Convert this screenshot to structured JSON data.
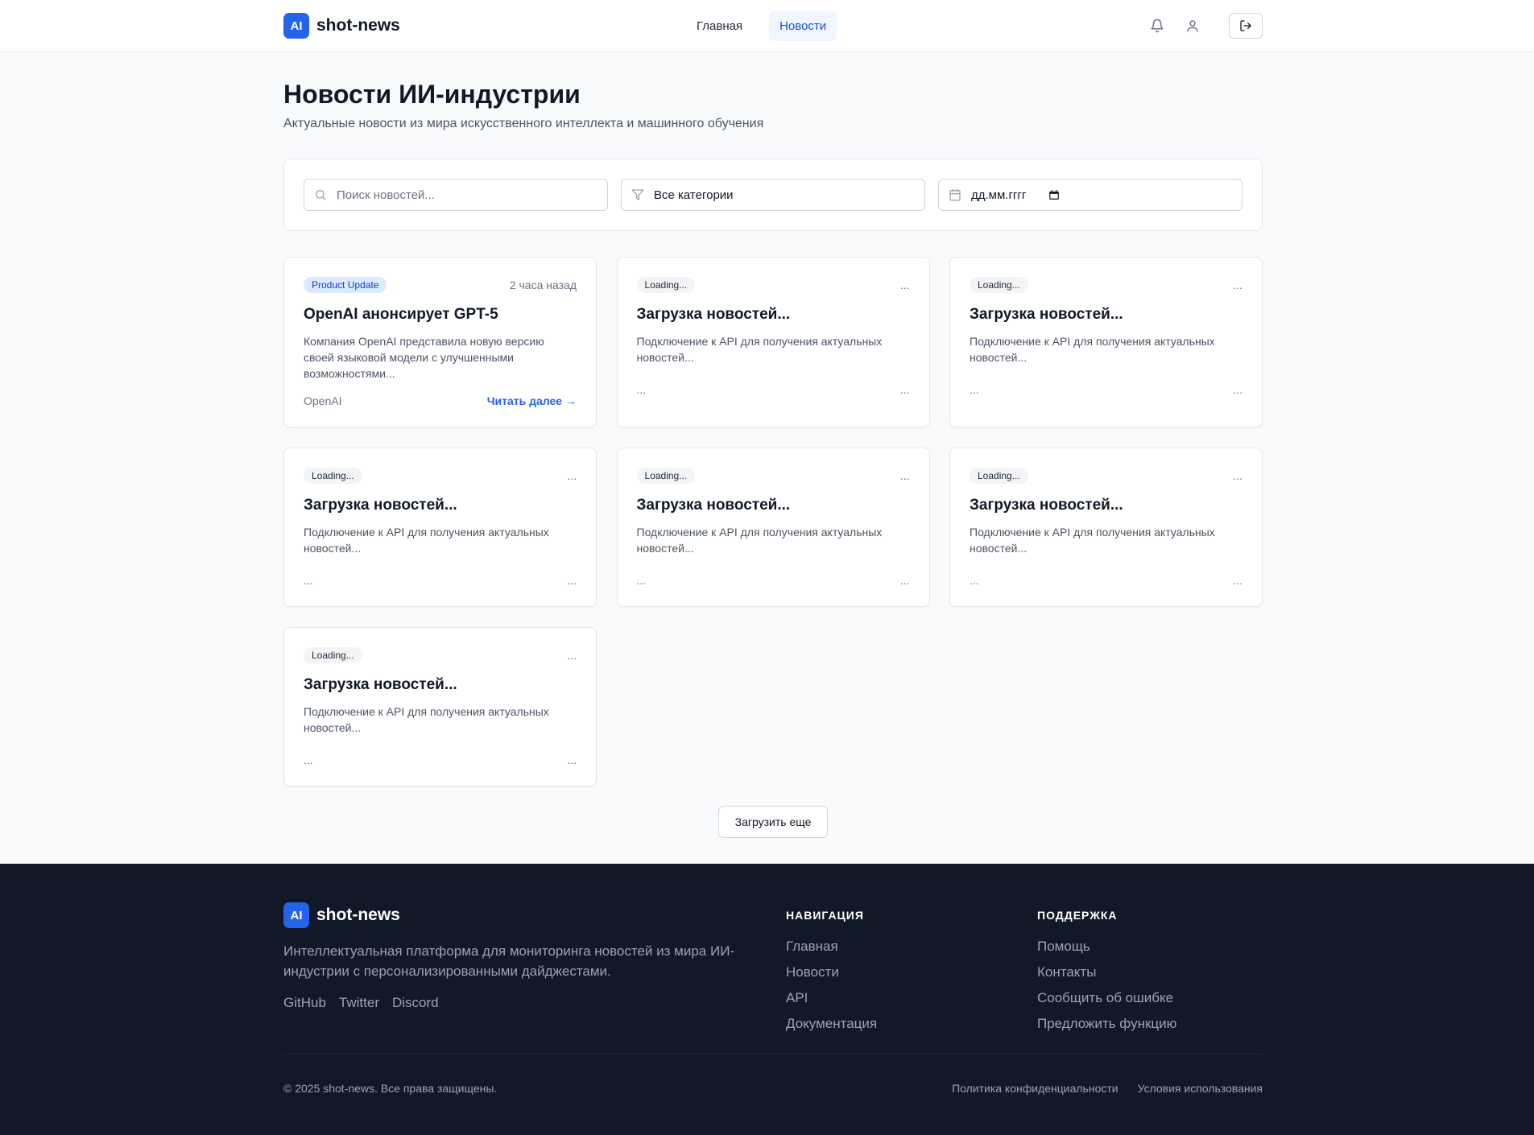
{
  "brand": {
    "logo_text": "AI",
    "name": "shot-news"
  },
  "header": {
    "nav": [
      {
        "label": "Главная",
        "active": false
      },
      {
        "label": "Новости",
        "active": true
      }
    ],
    "icons": [
      "bell-icon",
      "user-icon",
      "logout-icon"
    ]
  },
  "page": {
    "title": "Новости ИИ-индустрии",
    "subtitle": "Актуальные новости из мира искусственного интеллекта и машинного обучения"
  },
  "filters": {
    "search_placeholder": "Поиск новостей...",
    "category_value": "Все категории",
    "date_value": "дд.мм.гггг"
  },
  "news": {
    "featured": {
      "badge": "Product Update",
      "time": "2 часа назад",
      "title": "OpenAI анонсирует GPT-5",
      "description": "Компания OpenAI представила новую версию своей языковой модели с улучшенными возможностями...",
      "source": "OpenAI",
      "read_more": "Читать далее →"
    },
    "loading": [
      {
        "badge": "Loading...",
        "time": "...",
        "title": "Загрузка новостей...",
        "description": "Подключение к API для получения актуальных новостей...",
        "source": "...",
        "meta": "..."
      },
      {
        "badge": "Loading...",
        "time": "...",
        "title": "Загрузка новостей...",
        "description": "Подключение к API для получения актуальных новостей...",
        "source": "...",
        "meta": "..."
      },
      {
        "badge": "Loading...",
        "time": "...",
        "title": "Загрузка новостей...",
        "description": "Подключение к API для получения актуальных новостей...",
        "source": "...",
        "meta": "..."
      },
      {
        "badge": "Loading...",
        "time": "...",
        "title": "Загрузка новостей...",
        "description": "Подключение к API для получения актуальных новостей...",
        "source": "...",
        "meta": "..."
      },
      {
        "badge": "Loading...",
        "time": "...",
        "title": "Загрузка новостей...",
        "description": "Подключение к API для получения актуальных новостей...",
        "source": "...",
        "meta": "..."
      },
      {
        "badge": "Loading...",
        "time": "...",
        "title": "Загрузка новостей...",
        "description": "Подключение к API для получения актуальных новостей...",
        "source": "...",
        "meta": "..."
      }
    ],
    "load_more": "Загрузить еще"
  },
  "footer": {
    "description": "Интеллектуальная платформа для мониторинга новостей из мира ИИ-индустрии с персонализированными дайджестами.",
    "social": [
      "GitHub",
      "Twitter",
      "Discord"
    ],
    "nav_title": "НАВИГАЦИЯ",
    "nav_links": [
      "Главная",
      "Новости",
      "API",
      "Документация"
    ],
    "support_title": "ПОДДЕРЖКА",
    "support_links": [
      "Помощь",
      "Контакты",
      "Сообщить об ошибке",
      "Предложить функцию"
    ],
    "copyright": "© 2025 shot-news. Все права защищены.",
    "legal": [
      "Политика конфиденциальности",
      "Условия использования"
    ]
  },
  "colors": {
    "accent": "#2563eb",
    "footer_bg": "#111827",
    "page_bg": "#f9fafb"
  }
}
